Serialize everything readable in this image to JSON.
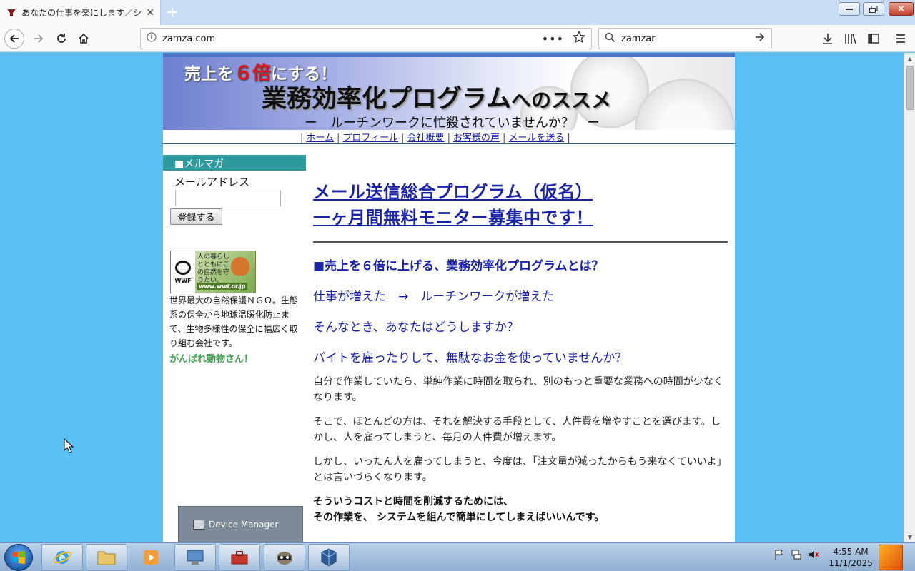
{
  "browser": {
    "tab_title": "あなたの仕事を楽にします／システム",
    "url": "zamza.com",
    "search_query": "zamzar"
  },
  "site": {
    "banner": {
      "line1_a": "売上を",
      "line1_red": "６倍",
      "line1_b": "にする！",
      "title_main": "業務効率化プログラム",
      "title_suffix": "へのススメ",
      "tagline": "ー　ルーチンワークに忙殺されていませんか？　ー"
    },
    "nav": [
      "ホーム",
      "プロフィール",
      "会社概要",
      "お客様の声",
      "メールを送る"
    ],
    "sidebar": {
      "header": "■メルマガ",
      "email_label": "メールアドレス",
      "register_button": "登録する",
      "wwf_url": "www.wwf.or.jp",
      "wwf_copy": "人の暮らしとともにこの自然を守りたい。",
      "wwf_label": "WWF",
      "wwf_desc": "世界最大の自然保護ＮＧＯ。生態系の保全から地球温暖化防止まで、生物多様性の保全に幅広く取り組む会社です。",
      "cheer": "がんばれ動物さん！"
    },
    "main": {
      "headline1": "メール送信総合プログラム（仮名）",
      "headline2": "一ヶ月間無料モニター募集中です！",
      "subheading": "■売上を６倍に上げる、業務効率化プログラムとは？",
      "lines": [
        "仕事が増えた　→　ルーチンワークが増えた",
        "そんなとき、あなたはどうしますか？",
        "バイトを雇ったりして、無駄なお金を使っていませんか？"
      ],
      "paragraphs": [
        "自分で作業していたら、単純作業に時間を取られ、別のもっと重要な業務への時間が少なくなります。",
        "そこで、ほとんどの方は、それを解決する手段として、人件費を増やすことを選びます。しかし、人を雇ってしまうと、毎月の人件費が増えます。",
        "しかし、いったん人を雇ってしまうと、今度は、「注文量が減ったからもう来なくていいよ」とは言いづらくなります。"
      ],
      "bold_line1": "そういうコストと時間を削減するためには、",
      "bold_line2": "その作業を、 システムを組んで簡単にしてしまえばいいんです。"
    }
  },
  "popup": {
    "device_manager": "Device Manager"
  },
  "taskbar": {
    "time": "4:55 AM",
    "date": "11/1/2025"
  },
  "colors": {
    "desktop_bg": "#5bc1f4",
    "link_blue": "#1a23a8",
    "sidebar_header": "#2f9a9d",
    "cheer_green": "#3fa04f"
  }
}
